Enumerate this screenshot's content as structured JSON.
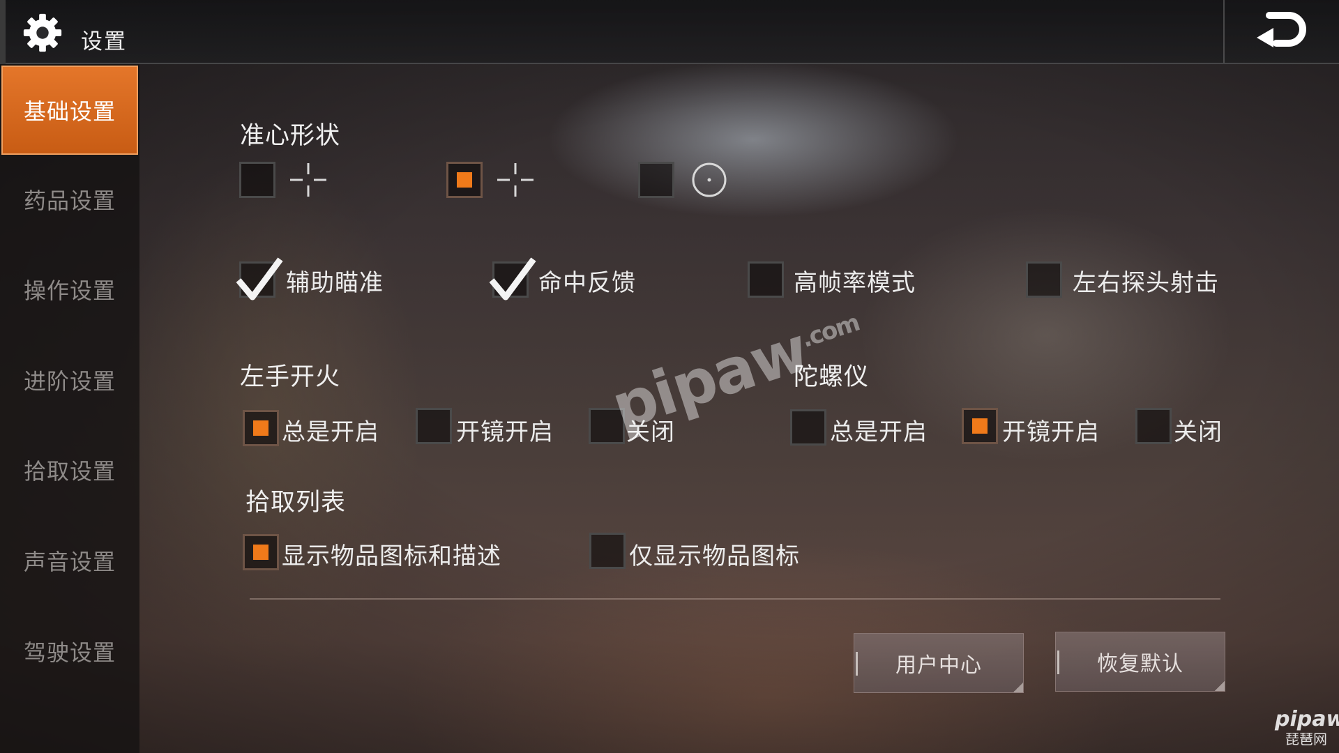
{
  "header": {
    "title": "设置",
    "settings_icon": "gear-icon",
    "back_icon": "back-arrow-icon"
  },
  "sidebar": {
    "items": [
      {
        "label": "基础设置",
        "active": true
      },
      {
        "label": "药品设置",
        "active": false
      },
      {
        "label": "操作设置",
        "active": false
      },
      {
        "label": "进阶设置",
        "active": false
      },
      {
        "label": "拾取设置",
        "active": false
      },
      {
        "label": "声音设置",
        "active": false
      },
      {
        "label": "驾驶设置",
        "active": false
      }
    ]
  },
  "crosshair": {
    "title": "准心形状",
    "options": [
      {
        "icon": "crosshair-cross-icon",
        "selected": false
      },
      {
        "icon": "crosshair-cross-icon",
        "selected": true
      },
      {
        "icon": "crosshair-circle-dot-icon",
        "selected": false
      }
    ]
  },
  "toggles": [
    {
      "label": "辅助瞄准",
      "checked": true
    },
    {
      "label": "命中反馈",
      "checked": true
    },
    {
      "label": "高帧率模式",
      "checked": false
    },
    {
      "label": "左右探头射击",
      "checked": false
    }
  ],
  "left_fire": {
    "title": "左手开火",
    "options": [
      {
        "label": "总是开启",
        "selected": true
      },
      {
        "label": "开镜开启",
        "selected": false
      },
      {
        "label": "关闭",
        "selected": false
      }
    ]
  },
  "gyroscope": {
    "title": "陀螺仪",
    "options": [
      {
        "label": "总是开启",
        "selected": false
      },
      {
        "label": "开镜开启",
        "selected": true
      },
      {
        "label": "关闭",
        "selected": false
      }
    ]
  },
  "pickup_list": {
    "title": "拾取列表",
    "options": [
      {
        "label": "显示物品图标和描述",
        "selected": true
      },
      {
        "label": "仅显示物品图标",
        "selected": false
      }
    ]
  },
  "buttons": {
    "user_center": "用户中心",
    "restore_default": "恢复默认"
  },
  "watermark": {
    "main": "pipaw",
    "suffix": ".com",
    "corner_top": "pipaw",
    "corner_bottom": "琵琶网"
  },
  "colors": {
    "accent": "#e4762a",
    "checkbox_fill": "#f07a1a"
  }
}
